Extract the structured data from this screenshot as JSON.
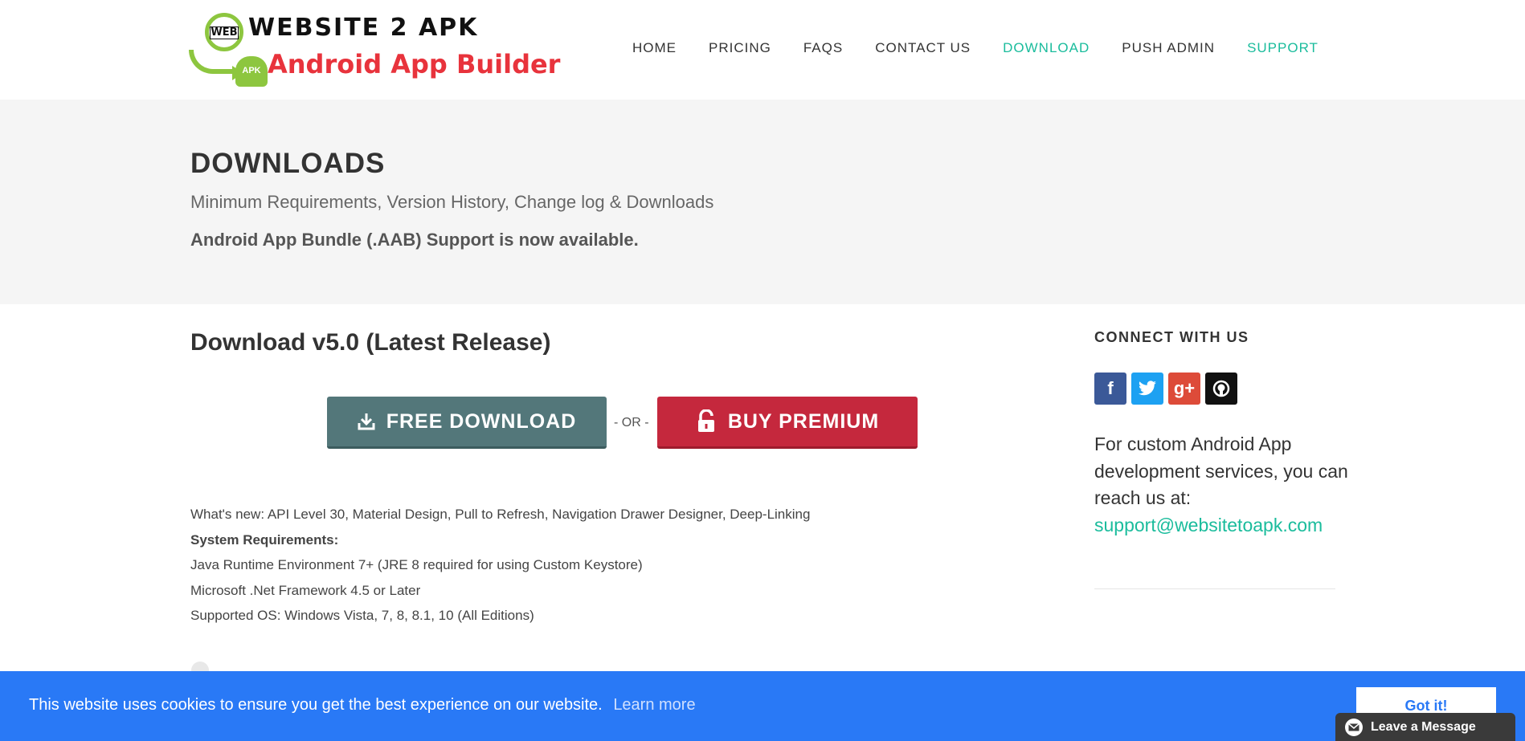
{
  "logo": {
    "globe_text": "WEB",
    "droid_text": "APK",
    "line1": "WEBSITE 2 APK",
    "line2": "Android App Builder"
  },
  "nav": {
    "items": [
      {
        "label": "HOME"
      },
      {
        "label": "PRICING"
      },
      {
        "label": "FAQS"
      },
      {
        "label": "CONTACT US"
      },
      {
        "label": "DOWNLOAD"
      },
      {
        "label": "PUSH ADMIN"
      },
      {
        "label": "SUPPORT"
      }
    ],
    "active_color": "#1abc9c"
  },
  "hero": {
    "title": "DOWNLOADS",
    "subtitle": "Minimum Requirements, Version History, Change log & Downloads",
    "note": "Android App Bundle (.AAB) Support is now available."
  },
  "main": {
    "download_title": "Download v5.0 (Latest Release)",
    "free_label": "FREE DOWNLOAD",
    "or_label": "- OR -",
    "premium_label": "BUY PREMIUM",
    "whats_new": "What's new: API Level 30, Material Design, Pull to Refresh, Navigation Drawer Designer, Deep-Linking",
    "sysreq_heading": "System Requirements:",
    "req_java": "Java Runtime Environment 7+ (JRE 8 required for using Custom Keystore)",
    "req_net": "Microsoft .Net Framework 4.5 or Later",
    "req_os": "Supported OS: Windows Vista, 7, 8, 8.1, 10 (All Editions)"
  },
  "sidebar": {
    "title": "CONNECT WITH US",
    "social": {
      "facebook": "f",
      "google_plus": "g+"
    },
    "text": "For custom Android App development services, you can reach us at:",
    "email": "support@websitetoapk.com"
  },
  "cookie": {
    "text": "This website uses cookies to ensure you get the best experience on our website.",
    "link": "Learn more",
    "button": "Got it!"
  },
  "chat": {
    "label": "Leave a Message"
  },
  "colors": {
    "accent": "#1abc9c",
    "free_button": "#53777a",
    "premium_button": "#c5283d",
    "cookie_bar": "#2979f6"
  }
}
